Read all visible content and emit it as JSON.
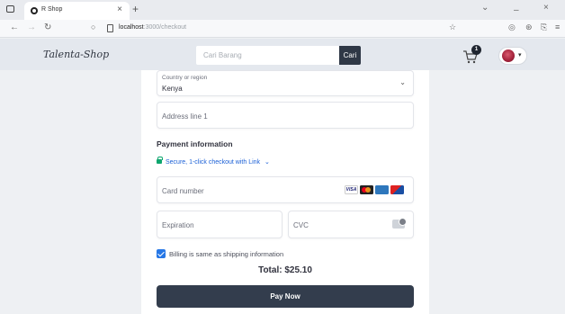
{
  "browser": {
    "tab_title": "R Shop",
    "url_host": "localhost",
    "url_rest": ":3000/checkout"
  },
  "header": {
    "brand": "Talenta-Shop",
    "search_placeholder": "Cari Barang",
    "search_button": "Cari",
    "cart_count": "1"
  },
  "checkout": {
    "country": {
      "label": "Country or region",
      "value": "Kenya"
    },
    "address_placeholder": "Address line 1",
    "payment_title": "Payment information",
    "link_text": "Secure, 1-click checkout with Link",
    "card_number_placeholder": "Card number",
    "card_brands": [
      "VISA",
      "Mastercard",
      "Amex",
      "Discover"
    ],
    "expiration_placeholder": "Expiration",
    "cvc_placeholder": "CVC",
    "billing_label": "Billing is same as shipping information",
    "billing_checked": true,
    "total": "Total: $25.10",
    "pay_button": "Pay Now"
  },
  "colors": {
    "header_bg": "#e4e8ee",
    "button_dark": "#333d4d",
    "link_green": "#0ea66e",
    "checkbox_blue": "#2677e6"
  }
}
